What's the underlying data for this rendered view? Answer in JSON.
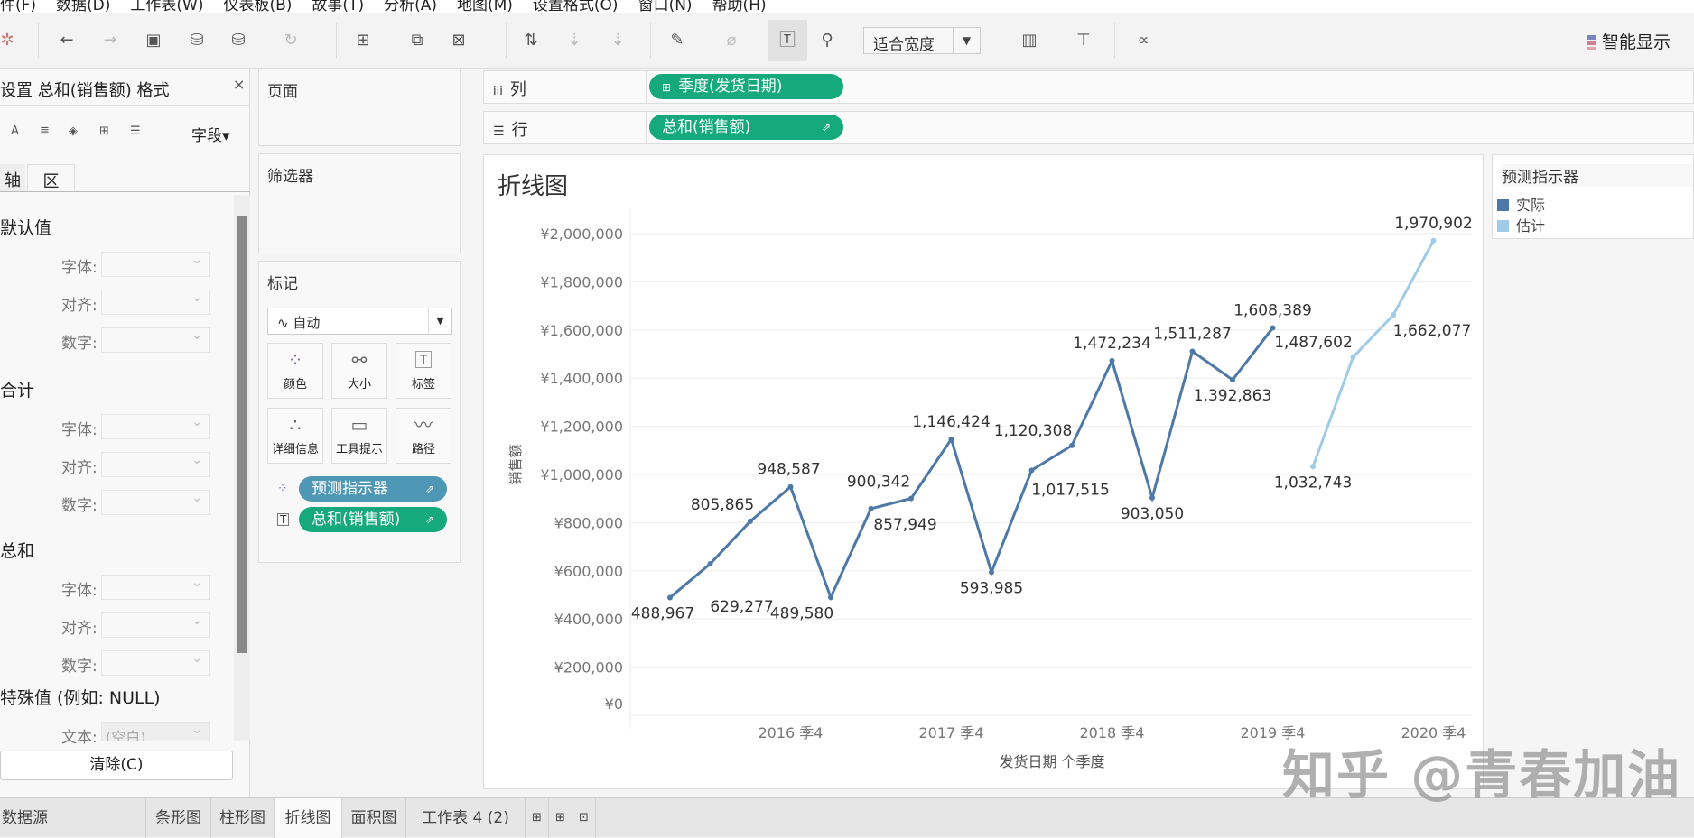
{
  "menu": [
    "件(F)",
    "数据(D)",
    "工作表(W)",
    "仪表板(B)",
    "故事(T)",
    "分析(A)",
    "地图(M)",
    "设置格式(O)",
    "窗口(N)",
    "帮助(H)"
  ],
  "toolbar": {
    "fit": "适合宽度",
    "show_me": "智能显示"
  },
  "format_panel": {
    "title": "设置 总和(销售额) 格式",
    "field": "字段▾",
    "tabs": [
      "轴",
      "区"
    ],
    "sections": [
      {
        "title": "默认值",
        "rows": [
          "字体:",
          "对齐:",
          "数字:"
        ]
      },
      {
        "title": "合计",
        "rows": [
          "字体:",
          "对齐:",
          "数字:"
        ]
      },
      {
        "title": "总和",
        "rows": [
          "字体:",
          "对齐:",
          "数字:"
        ]
      }
    ],
    "special": "特殊值 (例如: NULL)",
    "text_label": "文本:",
    "text_value": "(空白)",
    "clear": "清除(C)"
  },
  "cards": {
    "pages": "页面",
    "filters": "筛选器",
    "marks": "标记",
    "mark_type": "自动",
    "buttons": [
      "颜色",
      "大小",
      "标签",
      "详细信息",
      "工具提示",
      "路径"
    ],
    "pills": [
      "预测指示器",
      "总和(销售额)"
    ]
  },
  "shelves": {
    "columns_label": "列",
    "columns_pill": "季度(发货日期)",
    "rows_label": "行",
    "rows_pill": "总和(销售额)"
  },
  "legend": {
    "title": "预测指示器",
    "items": [
      {
        "label": "实际",
        "color": "#4e79a7"
      },
      {
        "label": "估计",
        "color": "#a0cbe8"
      }
    ]
  },
  "chart_data": {
    "type": "line",
    "title": "折线图",
    "xlabel": "发货日期 个季度",
    "ylabel": "销售额",
    "ylim": [
      0,
      2000000
    ],
    "yticks": [
      "¥2,000,000",
      "¥1,800,000",
      "¥1,600,000",
      "¥1,400,000",
      "¥1,200,000",
      "¥1,000,000",
      "¥800,000",
      "¥600,000",
      "¥400,000",
      "¥200,000",
      "¥0"
    ],
    "x": [
      "2016 季1",
      "2016 季2",
      "2016 季3",
      "2016 季4",
      "2017 季1",
      "2017 季2",
      "2017 季3",
      "2017 季4",
      "2018 季1",
      "2018 季2",
      "2018 季3",
      "2018 季4",
      "2019 季1",
      "2019 季2",
      "2019 季3",
      "2019 季4",
      "2020 季1",
      "2020 季2",
      "2020 季3",
      "2020 季4"
    ],
    "xticks": [
      {
        "index": 3,
        "label": "2016 季4"
      },
      {
        "index": 7,
        "label": "2017 季4"
      },
      {
        "index": 11,
        "label": "2018 季4"
      },
      {
        "index": 15,
        "label": "2019 季4"
      },
      {
        "index": 19,
        "label": "2020 季4"
      }
    ],
    "series": [
      {
        "name": "实际",
        "color": "#4e79a7",
        "start": 0,
        "values": [
          488967,
          629277,
          805865,
          948587,
          489580,
          857949,
          900342,
          1146424,
          593985,
          1017515,
          1120308,
          1472234,
          903050,
          1511287,
          1392863,
          1608389
        ],
        "labels": [
          "488,967",
          "629,277",
          "805,865",
          "948,587",
          "489,580",
          "857,949",
          "900,342",
          "1,146,424",
          "593,985",
          "1,017,515",
          "1,120,308",
          "1,472,234",
          "903,050",
          "1,511,287",
          "1,392,863",
          "1,608,389"
        ]
      },
      {
        "name": "估计",
        "color": "#a0cbe8",
        "start": 16,
        "values": [
          1032743,
          1487602,
          1662077,
          1970902
        ],
        "labels": [
          "1,032,743",
          "1,487,602",
          "1,662,077",
          "1,970,902"
        ]
      }
    ]
  },
  "sheet_tabs": {
    "datasource": "数据源",
    "tabs": [
      "条形图",
      "柱形图",
      "折线图",
      "面积图",
      "工作表 4 (2)"
    ],
    "active": 2
  },
  "watermark": "知乎 @青春加油"
}
